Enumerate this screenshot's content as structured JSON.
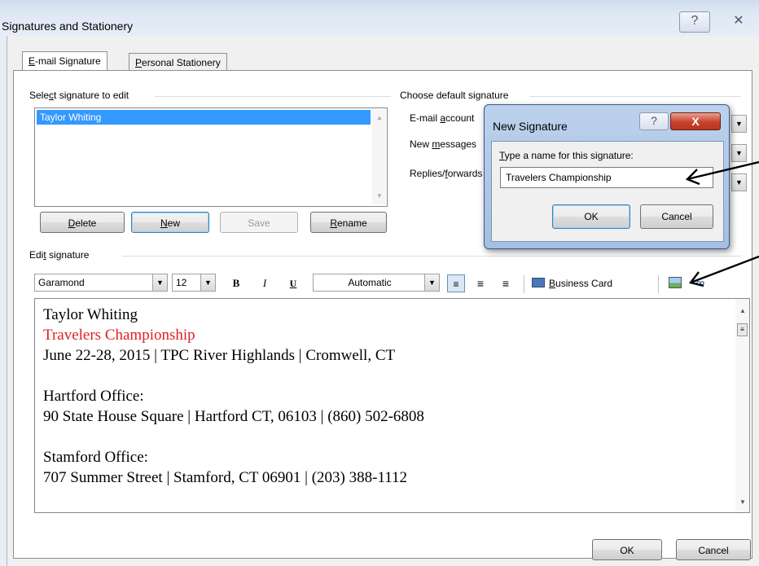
{
  "window": {
    "title": "Signatures and Stationery",
    "help_glyph": "?",
    "close_glyph": "✕"
  },
  "tabs": [
    {
      "label_key": "E",
      "label_rest": "-mail Signature"
    },
    {
      "label_key": "P",
      "label_rest": "ersonal Stationery"
    }
  ],
  "select_section": {
    "label_pre": "Sele",
    "label_key": "c",
    "label_post": "t signature to edit",
    "items": [
      "Taylor Whiting"
    ],
    "buttons": {
      "delete": {
        "key": "D",
        "rest": "elete"
      },
      "new": {
        "key": "N",
        "rest": "ew"
      },
      "save": "Save",
      "rename": {
        "key": "R",
        "rest": "ename"
      }
    }
  },
  "default_section": {
    "label": "Choose default signature",
    "rows": [
      {
        "pre": "E-mail ",
        "key": "a",
        "post": "ccount"
      },
      {
        "pre": "New ",
        "key": "m",
        "post": "essages"
      },
      {
        "pre": "Replies/",
        "key": "f",
        "post": "orwards"
      }
    ]
  },
  "edit_section": {
    "label_pre": "Edi",
    "label_key": "t",
    "label_post": " signature",
    "font": "Garamond",
    "size": "12",
    "bold": "B",
    "italic": "I",
    "underline": "U",
    "color": "Automatic",
    "business_card": {
      "key": "B",
      "rest": "usiness Card"
    },
    "lines": [
      {
        "text": "Taylor Whiting",
        "color": "#000000"
      },
      {
        "text": "Travelers Championship",
        "color": "#e02020"
      },
      {
        "text": "June 22-28, 2015 | TPC River Highlands | Cromwell, CT",
        "color": "#000000"
      },
      {
        "text": "",
        "color": "#000000"
      },
      {
        "text": "Hartford Office:",
        "color": "#000000"
      },
      {
        "text": "90 State House Square | Hartford CT, 06103 | (860) 502-6808",
        "color": "#000000"
      },
      {
        "text": "",
        "color": "#000000"
      },
      {
        "text": "Stamford Office:",
        "color": "#000000"
      },
      {
        "text": "707 Summer Street | Stamford, CT 06901 | (203) 388-1112",
        "color": "#000000"
      }
    ]
  },
  "footer": {
    "ok": "OK",
    "cancel": "Cancel"
  },
  "new_signature_dialog": {
    "title": "New Signature",
    "prompt_key": "T",
    "prompt_rest": "ype a name for this signature:",
    "value": "Travelers Championship",
    "ok": "OK",
    "cancel": "Cancel",
    "help_glyph": "?",
    "close_glyph": "X"
  },
  "colors": {
    "selection": "#3399ff",
    "signature_red": "#e02020",
    "dialog_frame": "#a4bfe2"
  }
}
